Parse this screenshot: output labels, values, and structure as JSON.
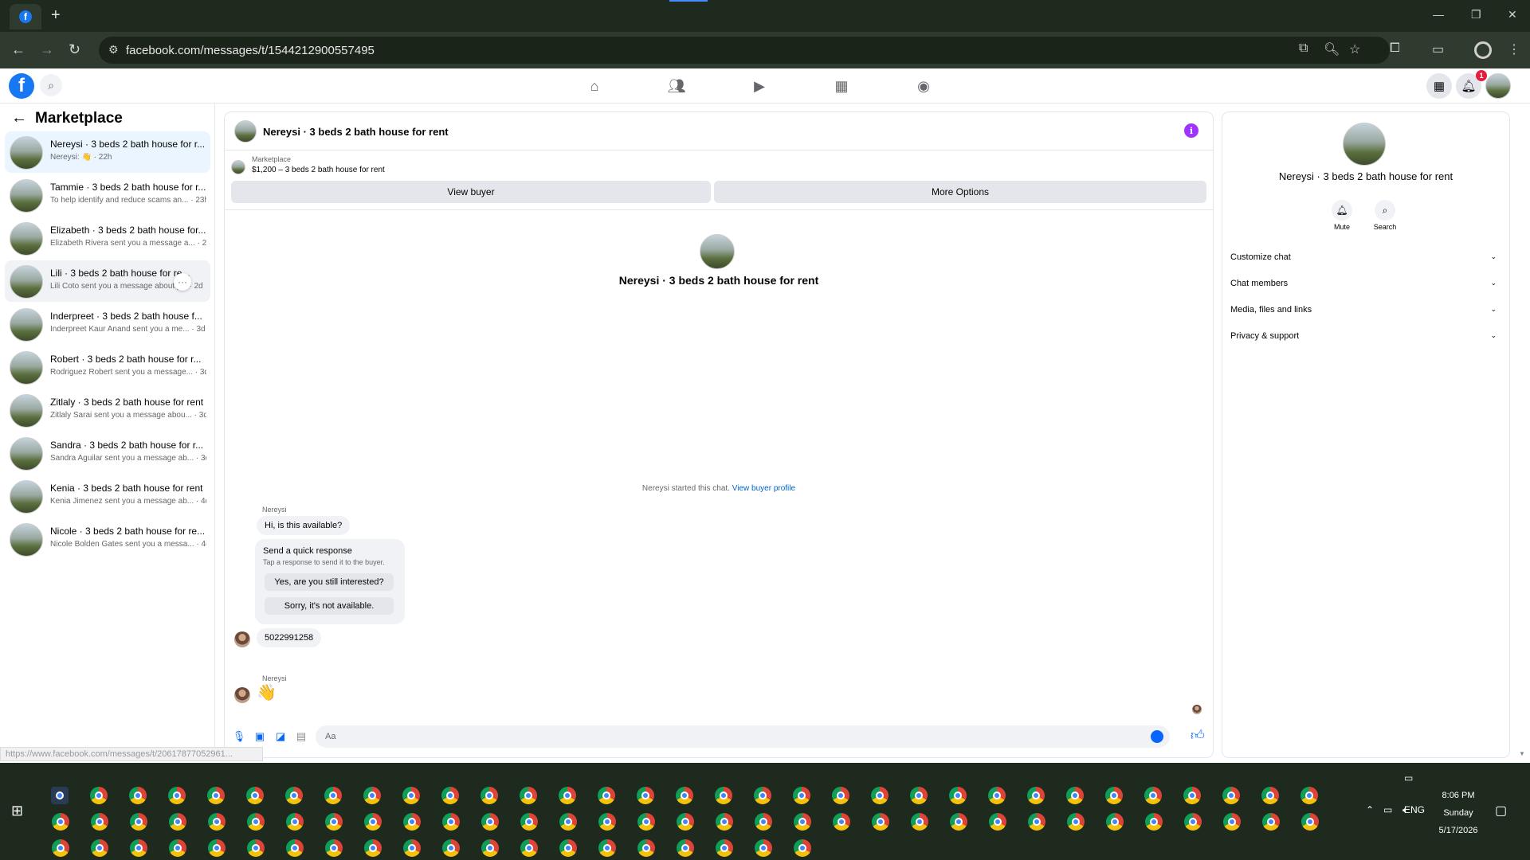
{
  "browser": {
    "url": "facebook.com/messages/t/1544212900557495",
    "new_tab_label": "+",
    "status_url": "https://www.facebook.com/messages/t/20617877052961..."
  },
  "fbnav": {
    "notification_count": "1"
  },
  "sidebar": {
    "title": "Marketplace",
    "conversations": [
      {
        "name": "Nereysi · 3 beds 2 bath house for r...",
        "preview": "Nereysi: 👋 · 22h"
      },
      {
        "name": "Tammie · 3 beds 2 bath house for r...",
        "preview": "To help identify and reduce scams an... · 23h"
      },
      {
        "name": "Elizabeth · 3 beds 2 bath house for...",
        "preview": "Elizabeth Rivera sent you a message a... · 2d"
      },
      {
        "name": "Lili · 3 beds 2 bath house for re...",
        "preview": "Lili Coto sent you a message about y... · 2d"
      },
      {
        "name": "Inderpreet · 3 beds 2 bath house f...",
        "preview": "Inderpreet Kaur Anand sent you a me... · 3d"
      },
      {
        "name": "Robert · 3 beds 2 bath house for r...",
        "preview": "Rodriguez Robert sent you a message... · 3d"
      },
      {
        "name": "Zitlaly · 3 beds 2 bath house for rent",
        "preview": "Zitlaly Sarai sent you a message abou... · 3d"
      },
      {
        "name": "Sandra · 3 beds 2 bath house for r...",
        "preview": "Sandra Aguilar sent you a message ab... · 3d"
      },
      {
        "name": "Kenia · 3 beds 2 bath house for rent",
        "preview": "Kenia Jimenez sent you a message ab... · 4d"
      },
      {
        "name": "Nicole · 3 beds 2 bath house for re...",
        "preview": "Nicole Bolden Gates sent you a messa... · 4d"
      }
    ],
    "more_label": "···"
  },
  "chat": {
    "title": "Nereysi · 3 beds 2 bath house for rent",
    "listing_category": "Marketplace",
    "listing_price": "$1,200 – 3 beds 2 bath house for rent",
    "view_buyer_label": "View buyer",
    "more_options_label": "More Options",
    "center_title": "Nereysi · 3 beds 2 bath house for rent",
    "started_text": "Nereysi started this chat. ",
    "started_link": "View buyer profile",
    "sender1": "Nereysi",
    "msg1": "Hi, is this available?",
    "quick_title": "Send a quick response",
    "quick_sub": "Tap a response to send it to the buyer.",
    "quick_opt1": "Yes, are you still interested?",
    "quick_opt2": "Sorry, it's not available.",
    "msg2": "5022991258",
    "sender2": "Nereysi",
    "msg3": "👋",
    "composer_placeholder": "Aa",
    "info_glyph": "i"
  },
  "rpanel": {
    "name": "Nereysi · 3 beds 2 bath house for rent",
    "mute_label": "Mute",
    "search_label": "Search",
    "sections": [
      "Customize chat",
      "Chat members",
      "Media, files and links",
      "Privacy & support"
    ]
  },
  "taskbar": {
    "time": "8:06 PM",
    "day": "Sunday",
    "date": "5/17/2026",
    "lang": "ENG"
  }
}
